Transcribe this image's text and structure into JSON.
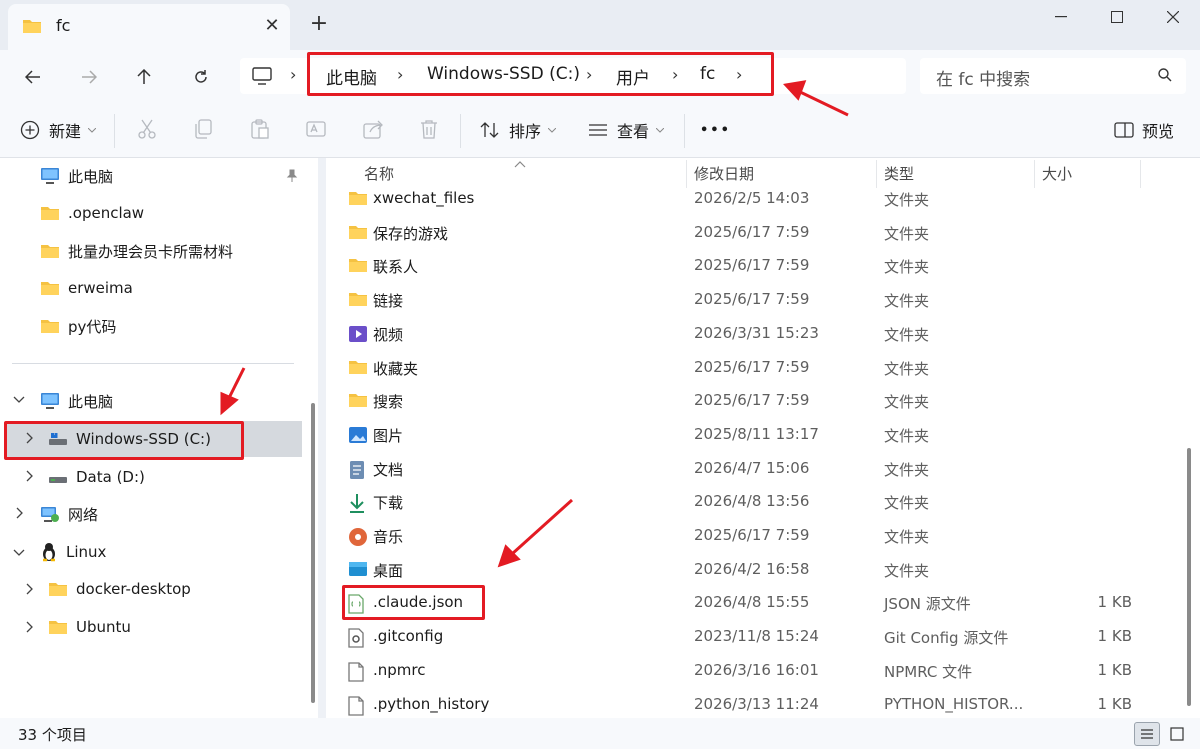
{
  "window": {
    "tab_title": "fc",
    "tab_close": "✕",
    "new_tab": "+",
    "folder_icon_color": "#f5c242"
  },
  "address": {
    "crumbs": [
      "此电脑",
      "Windows-SSD (C:)",
      "用户",
      "fc"
    ],
    "search_placeholder": "在 fc 中搜索"
  },
  "toolbar": {
    "new_label": "新建",
    "sort_label": "排序",
    "view_label": "查看",
    "more_label": "•••",
    "preview_label": "预览"
  },
  "sidebar": {
    "quick": [
      {
        "label": "此电脑",
        "icon": "monitor-icon"
      },
      {
        "label": ".openclaw",
        "icon": "folder-icon"
      },
      {
        "label": "批量办理会员卡所需材料",
        "icon": "folder-icon"
      },
      {
        "label": "erweima",
        "icon": "folder-icon"
      },
      {
        "label": "py代码",
        "icon": "folder-icon"
      }
    ],
    "tree": [
      {
        "label": "此电脑",
        "icon": "monitor-icon"
      },
      {
        "label": "Windows-SSD (C:)",
        "icon": "drive-icon"
      },
      {
        "label": "Data (D:)",
        "icon": "drive-icon"
      },
      {
        "label": "网络",
        "icon": "network-icon"
      },
      {
        "label": "Linux",
        "icon": "linux-icon"
      },
      {
        "label": "docker-desktop",
        "icon": "folder-icon"
      },
      {
        "label": "Ubuntu",
        "icon": "folder-icon"
      }
    ]
  },
  "columns": {
    "name": "名称",
    "date": "修改日期",
    "type": "类型",
    "size": "大小"
  },
  "files": [
    {
      "name": "xwechat_files",
      "date": "2026/2/5 14:03",
      "type": "文件夹",
      "size": "",
      "icon": "folder-icon"
    },
    {
      "name": "保存的游戏",
      "date": "2025/6/17 7:59",
      "type": "文件夹",
      "size": "",
      "icon": "folder-icon"
    },
    {
      "name": "联系人",
      "date": "2025/6/17 7:59",
      "type": "文件夹",
      "size": "",
      "icon": "folder-icon"
    },
    {
      "name": "链接",
      "date": "2025/6/17 7:59",
      "type": "文件夹",
      "size": "",
      "icon": "folder-icon"
    },
    {
      "name": "视频",
      "date": "2026/3/31 15:23",
      "type": "文件夹",
      "size": "",
      "icon": "video-icon"
    },
    {
      "name": "收藏夹",
      "date": "2025/6/17 7:59",
      "type": "文件夹",
      "size": "",
      "icon": "folder-icon"
    },
    {
      "name": "搜索",
      "date": "2025/6/17 7:59",
      "type": "文件夹",
      "size": "",
      "icon": "folder-icon"
    },
    {
      "name": "图片",
      "date": "2025/8/11 13:17",
      "type": "文件夹",
      "size": "",
      "icon": "picture-icon"
    },
    {
      "name": "文档",
      "date": "2026/4/7 15:06",
      "type": "文件夹",
      "size": "",
      "icon": "document-icon"
    },
    {
      "name": "下载",
      "date": "2026/4/8 13:56",
      "type": "文件夹",
      "size": "",
      "icon": "download-icon"
    },
    {
      "name": "音乐",
      "date": "2025/6/17 7:59",
      "type": "文件夹",
      "size": "",
      "icon": "music-icon"
    },
    {
      "name": "桌面",
      "date": "2026/4/2 16:58",
      "type": "文件夹",
      "size": "",
      "icon": "desktop-icon"
    },
    {
      "name": ".claude.json",
      "date": "2026/4/8 15:55",
      "type": "JSON 源文件",
      "size": "1 KB",
      "icon": "json-file-icon"
    },
    {
      "name": ".gitconfig",
      "date": "2023/11/8 15:24",
      "type": "Git Config 源文件",
      "size": "1 KB",
      "icon": "config-file-icon"
    },
    {
      "name": ".npmrc",
      "date": "2026/3/16 16:01",
      "type": "NPMRC 文件",
      "size": "1 KB",
      "icon": "file-icon"
    },
    {
      "name": ".python_history",
      "date": "2026/3/13 11:24",
      "type": "PYTHON_HISTOR...",
      "size": "1 KB",
      "icon": "file-icon"
    }
  ],
  "status": {
    "item_count": "33 个项目"
  },
  "colors": {
    "highlight": "#e31b23",
    "folder": "#f5c242",
    "selection": "#d5d9de"
  }
}
